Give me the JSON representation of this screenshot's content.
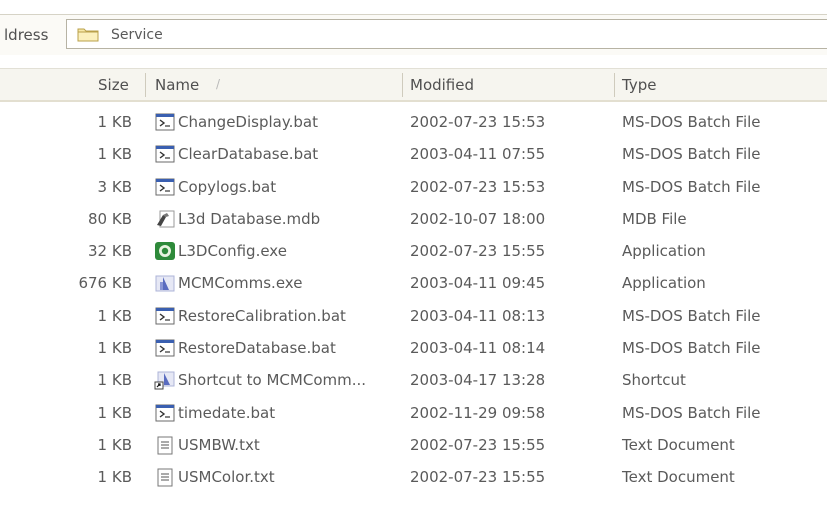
{
  "address": {
    "label": "ldress",
    "value": "Service",
    "folder_icon": "folder-icon"
  },
  "columns": {
    "size": "Size",
    "name": "Name",
    "sort_indicator": "/",
    "modified": "Modified",
    "type": "Type"
  },
  "files": [
    {
      "size": "1 KB",
      "name": "ChangeDisplay.bat",
      "modified": "2002-07-23 15:53",
      "type": "MS-DOS Batch File",
      "icon": "batch-file-icon"
    },
    {
      "size": "1 KB",
      "name": "ClearDatabase.bat",
      "modified": "2003-04-11 07:55",
      "type": "MS-DOS Batch File",
      "icon": "batch-file-icon"
    },
    {
      "size": "3 KB",
      "name": "Copylogs.bat",
      "modified": "2002-07-23 15:53",
      "type": "MS-DOS Batch File",
      "icon": "batch-file-icon"
    },
    {
      "size": "80 KB",
      "name": "L3d Database.mdb",
      "modified": "2002-10-07 18:00",
      "type": "MDB File",
      "icon": "mdb-file-icon"
    },
    {
      "size": "32 KB",
      "name": "L3DConfig.exe",
      "modified": "2002-07-23 15:55",
      "type": "Application",
      "icon": "config-app-icon"
    },
    {
      "size": "676 KB",
      "name": "MCMComms.exe",
      "modified": "2003-04-11 09:45",
      "type": "Application",
      "icon": "comms-app-icon"
    },
    {
      "size": "1 KB",
      "name": "RestoreCalibration.bat",
      "modified": "2003-04-11 08:13",
      "type": "MS-DOS Batch File",
      "icon": "batch-file-icon"
    },
    {
      "size": "1 KB",
      "name": "RestoreDatabase.bat",
      "modified": "2003-04-11 08:14",
      "type": "MS-DOS Batch File",
      "icon": "batch-file-icon"
    },
    {
      "size": "1 KB",
      "name": "Shortcut to MCMComm...",
      "modified": "2003-04-17 13:28",
      "type": "Shortcut",
      "icon": "shortcut-icon"
    },
    {
      "size": "1 KB",
      "name": "timedate.bat",
      "modified": "2002-11-29 09:58",
      "type": "MS-DOS Batch File",
      "icon": "batch-file-icon"
    },
    {
      "size": "1 KB",
      "name": "USMBW.txt",
      "modified": "2002-07-23 15:55",
      "type": "Text Document",
      "icon": "text-file-icon"
    },
    {
      "size": "1 KB",
      "name": "USMColor.txt",
      "modified": "2002-07-23 15:55",
      "type": "Text Document",
      "icon": "text-file-icon"
    }
  ]
}
